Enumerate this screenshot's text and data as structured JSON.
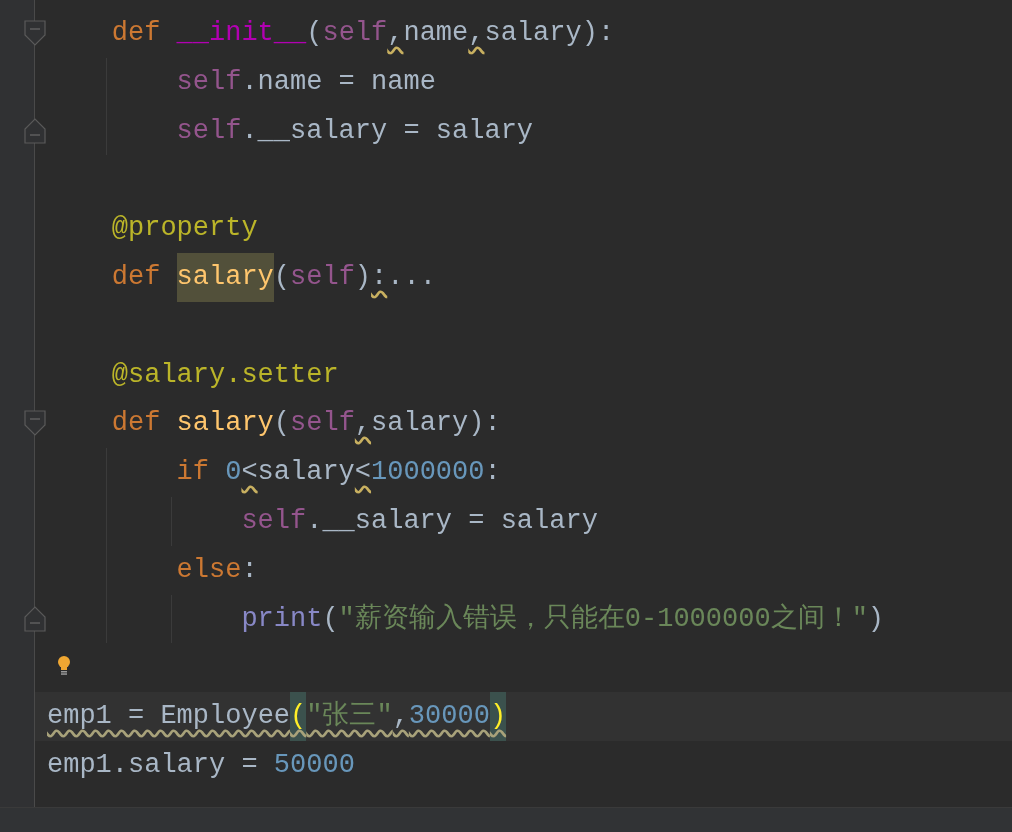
{
  "editor": {
    "lines": [
      {
        "children": [
          {
            "fold_start": true,
            "fold_end": false,
            "tokens": [
              {
                "text": "def ",
                "kind": "keyword"
              },
              {
                "text": "__init__",
                "kind": "magic"
              },
              {
                "text": "(",
                "kind": "plain"
              },
              {
                "text": "self",
                "kind": "self"
              },
              {
                "text": ",",
                "kind": "plain",
                "warning": true
              },
              {
                "text": "name",
                "kind": "plain"
              },
              {
                "text": ",",
                "kind": "plain",
                "warning": true
              },
              {
                "text": "salary):",
                "kind": "plain"
              }
            ],
            "children": [
              {
                "tokens": [
                  {
                    "text": "self",
                    "kind": "self"
                  },
                  {
                    "text": ".name = name",
                    "kind": "plain"
                  }
                ]
              },
              {
                "fold_start": false,
                "fold_end": true,
                "tokens": [
                  {
                    "text": "self",
                    "kind": "self"
                  },
                  {
                    "text": ".__salary = salary",
                    "kind": "plain"
                  }
                ]
              }
            ]
          },
          {
            "blank": true
          },
          {
            "tokens": [
              {
                "text": "@property",
                "kind": "decorator"
              }
            ]
          },
          {
            "tokens": [
              {
                "text": "def ",
                "kind": "keyword"
              },
              {
                "text": "salary",
                "kind": "function",
                "highlighted": true
              },
              {
                "text": "(",
                "kind": "plain"
              },
              {
                "text": "self",
                "kind": "self"
              },
              {
                "text": ")",
                "kind": "plain"
              },
              {
                "text": ":",
                "kind": "plain",
                "warning": true
              },
              {
                "text": "...",
                "kind": "plain"
              }
            ]
          },
          {
            "blank": true
          },
          {
            "tokens": [
              {
                "text": "@salary.setter",
                "kind": "decorator"
              }
            ]
          },
          {
            "fold_start": true,
            "fold_end": false,
            "tokens": [
              {
                "text": "def ",
                "kind": "keyword"
              },
              {
                "text": "salary",
                "kind": "function"
              },
              {
                "text": "(",
                "kind": "plain"
              },
              {
                "text": "self",
                "kind": "self"
              },
              {
                "text": ",",
                "kind": "plain",
                "warning": true
              },
              {
                "text": "salary):",
                "kind": "plain"
              }
            ],
            "children": [
              {
                "tokens": [
                  {
                    "text": "if ",
                    "kind": "keyword"
                  },
                  {
                    "text": "0",
                    "kind": "number"
                  },
                  {
                    "text": "<",
                    "kind": "plain",
                    "warning": true
                  },
                  {
                    "text": "salary",
                    "kind": "plain"
                  },
                  {
                    "text": "<",
                    "kind": "plain",
                    "warning": true
                  },
                  {
                    "text": "1000000",
                    "kind": "number"
                  },
                  {
                    "text": ":",
                    "kind": "plain"
                  }
                ],
                "children": [
                  {
                    "tokens": [
                      {
                        "text": "self",
                        "kind": "self"
                      },
                      {
                        "text": ".__salary = salary",
                        "kind": "plain"
                      }
                    ]
                  }
                ]
              },
              {
                "tokens": [
                  {
                    "text": "else",
                    "kind": "keyword"
                  },
                  {
                    "text": ":",
                    "kind": "plain"
                  }
                ],
                "children": [
                  {
                    "fold_start": false,
                    "fold_end": true,
                    "tokens": [
                      {
                        "text": "print",
                        "kind": "builtin"
                      },
                      {
                        "text": "(",
                        "kind": "plain"
                      },
                      {
                        "text": "\"薪资输入错误，只能在0-1000000之间！\"",
                        "kind": "string"
                      },
                      {
                        "text": ")",
                        "kind": "plain"
                      }
                    ]
                  }
                ]
              }
            ]
          }
        ]
      },
      {
        "blank": true,
        "bulb": true
      },
      {
        "current": true,
        "warning": true,
        "tokens": [
          {
            "text": "emp1 = Employee",
            "kind": "plain"
          },
          {
            "text": "(",
            "kind": "brace",
            "matched": true
          },
          {
            "text": "\"张三\"",
            "kind": "string"
          },
          {
            "text": ",",
            "kind": "plain"
          },
          {
            "text": "30000",
            "kind": "number"
          },
          {
            "text": ")",
            "kind": "brace",
            "matched": true
          }
        ]
      },
      {
        "current": false,
        "warning": false,
        "tokens": [
          {
            "text": "emp1.salary = ",
            "kind": "plain"
          },
          {
            "text": "50000",
            "kind": "number"
          }
        ]
      }
    ]
  }
}
